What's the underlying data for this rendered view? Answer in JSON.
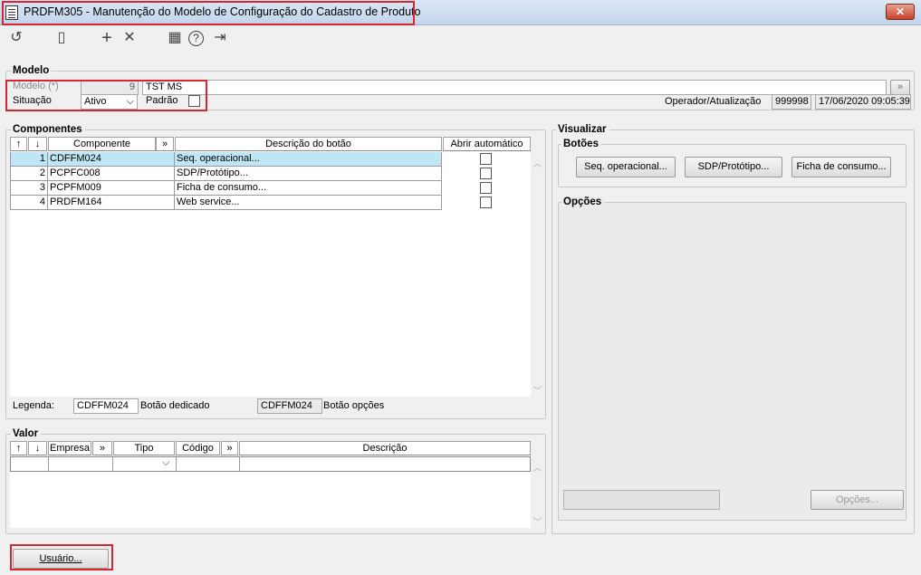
{
  "window": {
    "title": "PRDFM305 - Manutenção do Modelo de Configuração do Cadastro de Produto",
    "close": "✕"
  },
  "toolbar": {
    "undo": "↺",
    "save": "▯",
    "add": "+",
    "delete": "✕",
    "calendar": "▦",
    "help": "?",
    "exit": "⇥"
  },
  "modelo": {
    "legend": "Modelo",
    "modelo_label": "Modelo (*)",
    "modelo_value": "9",
    "modelo_desc": "TST MS",
    "situacao_label": "Situação",
    "situacao_value": "Ativo",
    "padrao_label": "Padrão",
    "operador_label": "Operador/Atualização",
    "operador_value": "999998",
    "atualizacao_value": "17/06/2020 09:05:39",
    "lookup_btn": "»"
  },
  "componentes": {
    "legend": "Componentes",
    "headers": {
      "up": "↑",
      "down": "↓",
      "componente": "Componente",
      "more": "»",
      "descricao": "Descrição do botão",
      "abrir": "Abrir automático"
    },
    "rows": [
      {
        "n": "1",
        "componente": "CDFFM024",
        "descricao": "Seq. operacional..."
      },
      {
        "n": "2",
        "componente": "PCPFC008",
        "descricao": "SDP/Protótipo..."
      },
      {
        "n": "3",
        "componente": "PCPFM009",
        "descricao": "Ficha de consumo..."
      },
      {
        "n": "4",
        "componente": "PRDFM164",
        "descricao": "Web service..."
      }
    ],
    "legenda_label": "Legenda:",
    "legenda_dedicado_value": "CDFFM024",
    "legenda_dedicado_label": "Botão dedicado",
    "legenda_opcoes_value": "CDFFM024",
    "legenda_opcoes_label": "Botão opções"
  },
  "valor": {
    "legend": "Valor",
    "headers": {
      "up": "↑",
      "down": "↓",
      "empresa": "Empresa",
      "more1": "»",
      "tipo": "Tipo",
      "codigo": "Código",
      "more2": "»",
      "descricao": "Descrição"
    }
  },
  "visualizar": {
    "legend": "Visualizar",
    "botoes_legend": "Botões",
    "buttons": [
      "Seq. operacional...",
      "SDP/Protótipo...",
      "Ficha de consumo..."
    ],
    "opcoes_legend": "Opções",
    "opcoes_btn": "Opções..."
  },
  "footer": {
    "usuario_btn": "Usuário..."
  }
}
